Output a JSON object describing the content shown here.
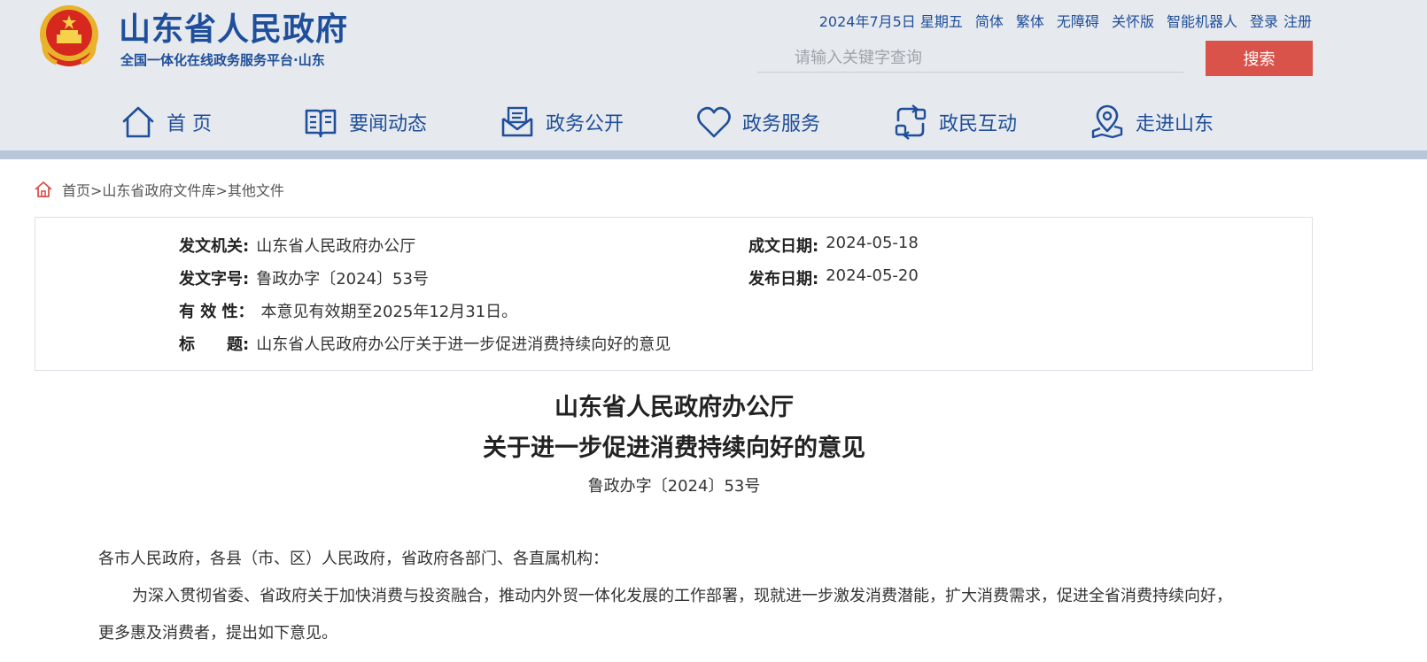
{
  "header": {
    "site_title": "山东省人民政府",
    "site_subtitle": "全国一体化在线政务服务平台·山东",
    "date": "2024年7月5日 星期五",
    "links": [
      "简体",
      "繁体",
      "无障碍",
      "关怀版",
      "智能机器人"
    ],
    "login": "登录",
    "register": "注册",
    "search_placeholder": "请输入关键字查询",
    "search_button": "搜索",
    "colors": {
      "brand": "#1f4f9a",
      "search_button": "#d9534a",
      "bar": "#b7c6d8"
    }
  },
  "nav": [
    {
      "label": "首 页",
      "icon": "home-icon"
    },
    {
      "label": "要闻动态",
      "icon": "book-icon"
    },
    {
      "label": "政务公开",
      "icon": "inbox-icon"
    },
    {
      "label": "政务服务",
      "icon": "heart-icon"
    },
    {
      "label": "政民互动",
      "icon": "interaction-icon"
    },
    {
      "label": "走进山东",
      "icon": "map-pin-icon"
    }
  ],
  "breadcrumb": {
    "icon": "home-icon",
    "items": [
      "首页",
      "山东省政府文件库",
      "其他文件"
    ],
    "separator": ">"
  },
  "meta": {
    "issuer_label": "发文机关:",
    "issuer": "山东省人民政府办公厅",
    "doc_no_label": "发文字号:",
    "doc_no": "鲁政办字〔2024〕53号",
    "validity_label": "有 效 性：",
    "validity": "本意见有效期至2025年12月31日。",
    "title_label": "标　　题:",
    "title": "山东省人民政府办公厅关于进一步促进消费持续向好的意见",
    "created_label": "成文日期:",
    "created": "2024-05-18",
    "published_label": "发布日期:",
    "published": "2024-05-20"
  },
  "document": {
    "title_line1": "山东省人民政府办公厅",
    "title_line2": "关于进一步促进消费持续向好的意见",
    "doc_no": "鲁政办字〔2024〕53号",
    "addressee": "各市人民政府，各县（市、区）人民政府，省政府各部门、各直属机构：",
    "para1": "为深入贯彻省委、省政府关于加快消费与投资融合，推动内外贸一体化发展的工作部署，现就进一步激发消费潜能，扩大消费需求，促进全省消费持续向好，更多惠及消费者，提出如下意见。"
  }
}
